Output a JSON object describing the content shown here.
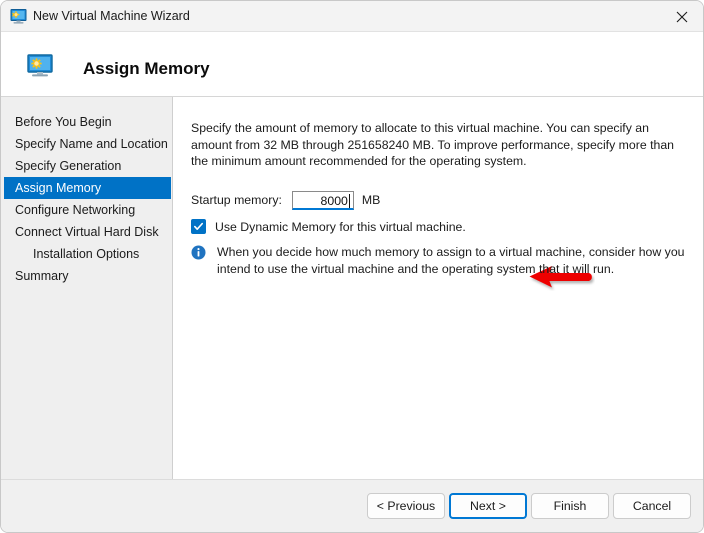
{
  "titlebar": {
    "title": "New Virtual Machine Wizard",
    "icon": "virtual-machine-icon",
    "close_label": "×"
  },
  "header": {
    "title": "Assign Memory",
    "icon": "virtual-machine-icon"
  },
  "sidebar": {
    "items": [
      {
        "label": "Before You Begin",
        "selected": false,
        "sub": false
      },
      {
        "label": "Specify Name and Location",
        "selected": false,
        "sub": false
      },
      {
        "label": "Specify Generation",
        "selected": false,
        "sub": false
      },
      {
        "label": "Assign Memory",
        "selected": true,
        "sub": false
      },
      {
        "label": "Configure Networking",
        "selected": false,
        "sub": false
      },
      {
        "label": "Connect Virtual Hard Disk",
        "selected": false,
        "sub": false
      },
      {
        "label": "Installation Options",
        "selected": false,
        "sub": true
      },
      {
        "label": "Summary",
        "selected": false,
        "sub": false
      }
    ]
  },
  "content": {
    "intro": "Specify the amount of memory to allocate to this virtual machine. You can specify an amount from 32 MB through 251658240 MB. To improve performance, specify more than the minimum amount recommended for the operating system.",
    "memory_label": "Startup memory:",
    "memory_value": "8000",
    "memory_unit": "MB",
    "dynamic_memory_label": "Use Dynamic Memory for this virtual machine.",
    "dynamic_memory_checked": true,
    "info_text": "When you decide how much memory to assign to a virtual machine, consider how you intend to use the virtual machine and the operating system that it will run.",
    "annotation": "red-left-arrow pointing at startup memory field"
  },
  "footer": {
    "previous_label": "< Previous",
    "next_label": "Next >",
    "finish_label": "Finish",
    "cancel_label": "Cancel"
  },
  "colors": {
    "accent": "#0072c6",
    "focus": "#0078d4",
    "annotation": "#ee0000",
    "sidebar_bg": "#efefef",
    "footer_bg": "#f0f0f0",
    "titlebar_bg": "#f3f3f3"
  }
}
